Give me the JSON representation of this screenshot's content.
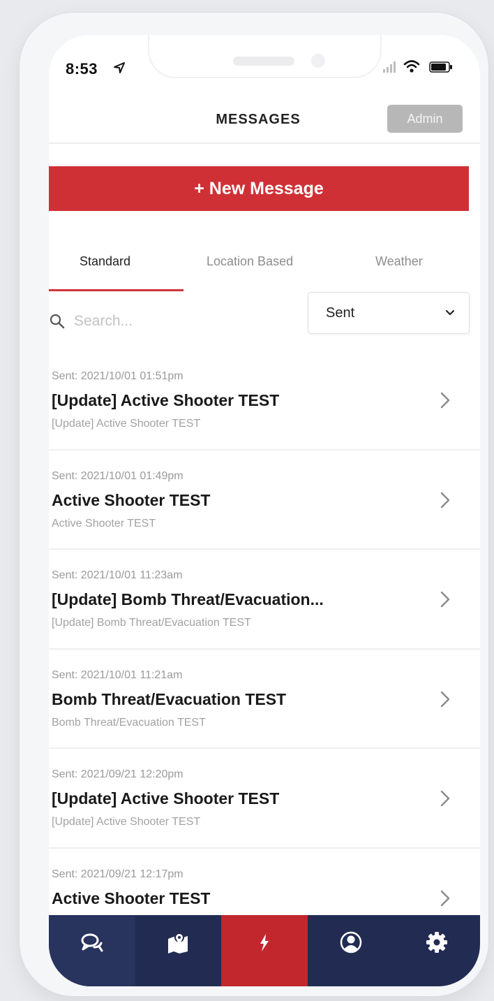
{
  "status_bar": {
    "time": "8:53"
  },
  "header": {
    "title": "MESSAGES",
    "admin_label": "Admin"
  },
  "new_message_label": "+ New Message",
  "tabs": [
    {
      "label": "Standard",
      "active": true
    },
    {
      "label": "Location Based",
      "active": false
    },
    {
      "label": "Weather",
      "active": false
    }
  ],
  "search": {
    "placeholder": "Search...",
    "value": ""
  },
  "filter": {
    "selected": "Sent"
  },
  "messages": [
    {
      "meta": "Sent: 2021/10/01 01:51pm",
      "title": "[Update] Active Shooter TEST",
      "subtitle": "[Update] Active Shooter TEST"
    },
    {
      "meta": "Sent: 2021/10/01 01:49pm",
      "title": "Active Shooter TEST",
      "subtitle": "Active Shooter TEST"
    },
    {
      "meta": "Sent: 2021/10/01 11:23am",
      "title": "[Update] Bomb Threat/Evacuation...",
      "subtitle": "[Update] Bomb Threat/Evacuation TEST"
    },
    {
      "meta": "Sent: 2021/10/01 11:21am",
      "title": "Bomb Threat/Evacuation TEST",
      "subtitle": "Bomb Threat/Evacuation TEST"
    },
    {
      "meta": "Sent: 2021/09/21 12:20pm",
      "title": "[Update] Active Shooter TEST",
      "subtitle": "[Update] Active Shooter TEST"
    },
    {
      "meta": "Sent: 2021/09/21 12:17pm",
      "title": "Active Shooter TEST",
      "subtitle": ""
    }
  ],
  "bottom_nav": [
    {
      "icon": "chat-bubbles-icon"
    },
    {
      "icon": "map-pin-icon"
    },
    {
      "icon": "lightning-bolt-icon",
      "active": true
    },
    {
      "icon": "user-profile-icon"
    },
    {
      "icon": "gear-icon"
    }
  ],
  "colors": {
    "accent_red": "#cf3036",
    "nav_bg": "#222c53",
    "nav_active": "#c1272d",
    "admin_gray": "#b7b7b7"
  }
}
